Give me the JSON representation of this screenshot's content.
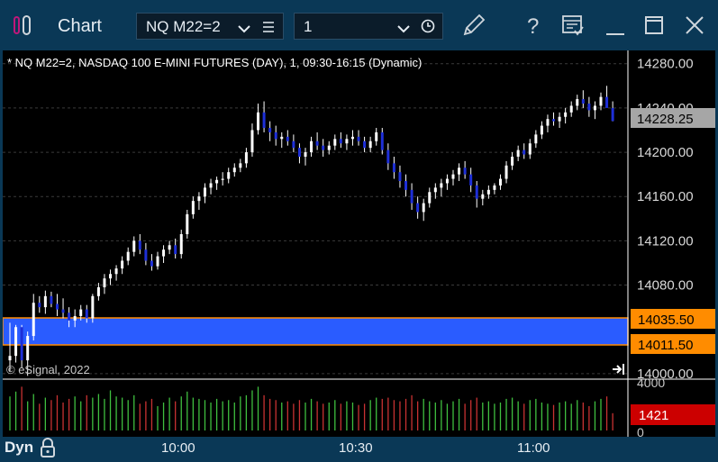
{
  "window": {
    "title": "Chart"
  },
  "toolbar": {
    "symbol_value": "NQ M22=2",
    "interval_value": "1"
  },
  "chart": {
    "header": "* NQ M22=2, NASDAQ 100 E-MINI FUTURES (DAY), 1, 09:30-16:15 (Dynamic)",
    "copyright": "© eSignal, 2022",
    "last_price": "14228.25",
    "zone_top": "14035.50",
    "zone_bottom": "14011.50",
    "volume_max": "4000",
    "volume_zero": "0",
    "volume_last": "1421",
    "bottom_mode": "Dyn"
  },
  "chart_data": {
    "type": "candlestick",
    "y_ticks": [
      "14280.00",
      "14240.00",
      "14200.00",
      "14160.00",
      "14120.00",
      "14080.00",
      "14000.00"
    ],
    "ylim": [
      13995,
      14292
    ],
    "x_ticks": [
      "10:00",
      "10:30",
      "11:00"
    ],
    "zone": {
      "top": 14035.5,
      "bottom": 14011.5,
      "color": "#2a5cff"
    },
    "colors": {
      "up": "#ffffff",
      "down": "#1e2fd8",
      "vol_up": "#3fbf3f",
      "vol_down": "#c83232",
      "last_bg": "#a6a6a6",
      "zone_label_bg": "#ff8c00",
      "vol_last_bg": "#cc0000"
    },
    "candles": [
      [
        14012,
        14046,
        14002,
        14016
      ],
      [
        14016,
        14044,
        14010,
        14042
      ],
      [
        14042,
        14044,
        14005,
        14012
      ],
      [
        14012,
        14038,
        13998,
        14034
      ],
      [
        14034,
        14072,
        14030,
        14064
      ],
      [
        14064,
        14070,
        14055,
        14060
      ],
      [
        14060,
        14075,
        14054,
        14070
      ],
      [
        14070,
        14074,
        14060,
        14063
      ],
      [
        14063,
        14072,
        14052,
        14058
      ],
      [
        14058,
        14068,
        14050,
        14055
      ],
      [
        14055,
        14060,
        14042,
        14048
      ],
      [
        14048,
        14058,
        14042,
        14052
      ],
      [
        14052,
        14062,
        14048,
        14058
      ],
      [
        14058,
        14062,
        14046,
        14050
      ],
      [
        14050,
        14072,
        14046,
        14070
      ],
      [
        14070,
        14082,
        14066,
        14078
      ],
      [
        14078,
        14090,
        14072,
        14086
      ],
      [
        14086,
        14094,
        14080,
        14090
      ],
      [
        14090,
        14098,
        14084,
        14095
      ],
      [
        14095,
        14106,
        14090,
        14102
      ],
      [
        14102,
        14114,
        14098,
        14110
      ],
      [
        14110,
        14124,
        14106,
        14120
      ],
      [
        14120,
        14126,
        14108,
        14112
      ],
      [
        14112,
        14118,
        14098,
        14102
      ],
      [
        14102,
        14108,
        14093,
        14097
      ],
      [
        14097,
        14110,
        14094,
        14106
      ],
      [
        14106,
        14116,
        14100,
        14112
      ],
      [
        14112,
        14120,
        14108,
        14116
      ],
      [
        14116,
        14122,
        14104,
        14108
      ],
      [
        14108,
        14130,
        14104,
        14126
      ],
      [
        14126,
        14148,
        14122,
        14144
      ],
      [
        14144,
        14160,
        14140,
        14156
      ],
      [
        14156,
        14164,
        14148,
        14160
      ],
      [
        14160,
        14172,
        14154,
        14168
      ],
      [
        14168,
        14176,
        14162,
        14172
      ],
      [
        14172,
        14178,
        14166,
        14175
      ],
      [
        14175,
        14182,
        14170,
        14176
      ],
      [
        14176,
        14186,
        14172,
        14182
      ],
      [
        14182,
        14190,
        14178,
        14186
      ],
      [
        14186,
        14194,
        14182,
        14190
      ],
      [
        14190,
        14204,
        14186,
        14200
      ],
      [
        14200,
        14226,
        14196,
        14220
      ],
      [
        14220,
        14244,
        14216,
        14236
      ],
      [
        14236,
        14246,
        14218,
        14222
      ],
      [
        14222,
        14228,
        14210,
        14218
      ],
      [
        14218,
        14224,
        14206,
        14212
      ],
      [
        14212,
        14218,
        14204,
        14214
      ],
      [
        14214,
        14220,
        14206,
        14210
      ],
      [
        14210,
        14216,
        14200,
        14204
      ],
      [
        14204,
        14208,
        14190,
        14196
      ],
      [
        14196,
        14204,
        14188,
        14200
      ],
      [
        14200,
        14214,
        14196,
        14210
      ],
      [
        14210,
        14218,
        14202,
        14206
      ],
      [
        14206,
        14212,
        14196,
        14202
      ],
      [
        14202,
        14210,
        14198,
        14206
      ],
      [
        14206,
        14216,
        14202,
        14212
      ],
      [
        14212,
        14218,
        14204,
        14208
      ],
      [
        14208,
        14216,
        14202,
        14212
      ],
      [
        14212,
        14220,
        14206,
        14214
      ],
      [
        14214,
        14220,
        14206,
        14210
      ],
      [
        14210,
        14214,
        14200,
        14204
      ],
      [
        14204,
        14214,
        14200,
        14210
      ],
      [
        14210,
        14222,
        14206,
        14218
      ],
      [
        14218,
        14222,
        14198,
        14202
      ],
      [
        14202,
        14208,
        14184,
        14190
      ],
      [
        14190,
        14196,
        14176,
        14182
      ],
      [
        14182,
        14188,
        14168,
        14174
      ],
      [
        14174,
        14180,
        14160,
        14166
      ],
      [
        14166,
        14172,
        14148,
        14154
      ],
      [
        14154,
        14160,
        14140,
        14146
      ],
      [
        14146,
        14158,
        14138,
        14154
      ],
      [
        14154,
        14168,
        14150,
        14164
      ],
      [
        14164,
        14172,
        14158,
        14168
      ],
      [
        14168,
        14176,
        14160,
        14172
      ],
      [
        14172,
        14180,
        14166,
        14176
      ],
      [
        14176,
        14184,
        14170,
        14180
      ],
      [
        14180,
        14190,
        14174,
        14186
      ],
      [
        14186,
        14192,
        14176,
        14180
      ],
      [
        14180,
        14186,
        14164,
        14170
      ],
      [
        14170,
        14174,
        14150,
        14158
      ],
      [
        14158,
        14166,
        14152,
        14162
      ],
      [
        14162,
        14170,
        14158,
        14166
      ],
      [
        14166,
        14172,
        14162,
        14170
      ],
      [
        14170,
        14180,
        14166,
        14176
      ],
      [
        14176,
        14192,
        14172,
        14188
      ],
      [
        14188,
        14200,
        14184,
        14196
      ],
      [
        14196,
        14206,
        14192,
        14202
      ],
      [
        14202,
        14208,
        14194,
        14198
      ],
      [
        14198,
        14212,
        14194,
        14208
      ],
      [
        14208,
        14220,
        14204,
        14216
      ],
      [
        14216,
        14228,
        14212,
        14224
      ],
      [
        14224,
        14234,
        14218,
        14230
      ],
      [
        14230,
        14236,
        14224,
        14228
      ],
      [
        14228,
        14236,
        14222,
        14232
      ],
      [
        14232,
        14240,
        14226,
        14236
      ],
      [
        14236,
        14246,
        14232,
        14242
      ],
      [
        14242,
        14252,
        14238,
        14248
      ],
      [
        14248,
        14256,
        14240,
        14244
      ],
      [
        14244,
        14250,
        14232,
        14238
      ],
      [
        14238,
        14246,
        14230,
        14242
      ],
      [
        14242,
        14254,
        14238,
        14250
      ],
      [
        14250,
        14260,
        14244,
        14240
      ],
      [
        14240,
        14246,
        14228,
        14228.25
      ]
    ],
    "volume": [
      2800,
      3200,
      3600,
      2400,
      3000,
      2200,
      2700,
      2500,
      2900,
      2300,
      2600,
      2800,
      2400,
      2900,
      2700,
      3000,
      2600,
      3300,
      2800,
      2700,
      2500,
      2900,
      2200,
      2400,
      2600,
      2000,
      2300,
      2700,
      2400,
      2800,
      3200,
      2700,
      2600,
      2500,
      2300,
      2600,
      2400,
      2500,
      2300,
      2800,
      2900,
      3300,
      3600,
      2900,
      2600,
      2500,
      2300,
      2400,
      2200,
      2500,
      2300,
      2600,
      2400,
      2200,
      2300,
      2500,
      2200,
      2400,
      2300,
      2100,
      2200,
      2500,
      2700,
      2600,
      2700,
      2500,
      2400,
      2600,
      2900,
      2400,
      2600,
      2400,
      2300,
      2500,
      2200,
      2400,
      2600,
      2200,
      2500,
      2700,
      2300,
      2400,
      2200,
      2300,
      2600,
      2700,
      2400,
      2200,
      2500,
      2600,
      2300,
      2200,
      2100,
      2300,
      2400,
      2200,
      2500,
      2300,
      2000,
      2400,
      2600,
      2800,
      1421
    ]
  }
}
